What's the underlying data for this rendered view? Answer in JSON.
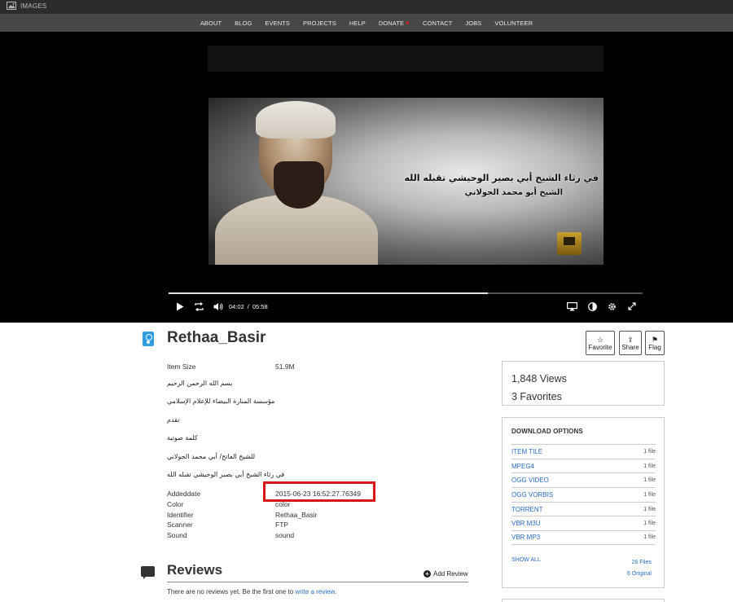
{
  "topbar": {
    "brand_label": "IMAGES",
    "brand_icon": "images-icon"
  },
  "nav": {
    "items": [
      "ABOUT",
      "BLOG",
      "EVENTS",
      "PROJECTS",
      "HELP",
      "DONATE",
      "CONTACT",
      "JOBS",
      "VOLUNTEER"
    ],
    "donate_icon": "heart-icon"
  },
  "player": {
    "caption_line1": "في رثاء الشيخ أبي بصير الوحيشي تقبله الله",
    "caption_line2": "الشيخ أبو محمد الجولاني",
    "current_time": "04:02",
    "separator": "/",
    "duration": "05:58",
    "progress_fraction": 0.674,
    "icons": [
      "play-icon",
      "loop-icon",
      "volume-icon",
      "airplay-icon",
      "contrast-icon",
      "settings-icon",
      "fullscreen-icon"
    ]
  },
  "item": {
    "title": "Rethaa_Basir",
    "type_icon": "audio-item-icon",
    "actions": [
      {
        "label": "Favorite",
        "icon": "star-icon",
        "glyph": "☆"
      },
      {
        "label": "Share",
        "icon": "share-icon",
        "glyph": "⇪"
      },
      {
        "label": "Flag",
        "icon": "flag-icon",
        "glyph": "⚑"
      }
    ],
    "item_size_label": "Item Size",
    "item_size_value": "51.9M",
    "description_lines": [
      "بسم الله الرحمن الرحيم",
      "مؤسسة المنارة البيضاء للإعلام الإسلامي",
      "تقدم",
      "كلمة صوتية",
      "للشيخ الفاتح/ أبي محمد الجولاني",
      "في رثاء الشيخ أبي بصير الوحيشي تقبله الله"
    ],
    "metadata": [
      {
        "key": "Addeddate",
        "value": "2015-06-23 16:52:27.76349"
      },
      {
        "key": "Color",
        "value": "color"
      },
      {
        "key": "Identifier",
        "value": "Rethaa_Basir"
      },
      {
        "key": "Scanner",
        "value": "FTP"
      },
      {
        "key": "Sound",
        "value": "sound"
      }
    ]
  },
  "stats": {
    "views": "1,848 Views",
    "favorites": "3 Favorites"
  },
  "downloads": {
    "title": "DOWNLOAD OPTIONS",
    "formats": [
      {
        "name": "ITEM TILE",
        "count": "1 file"
      },
      {
        "name": "MPEG4",
        "count": "1 file"
      },
      {
        "name": "OGG VIDEO",
        "count": "1 file"
      },
      {
        "name": "OGG VORBIS",
        "count": "1 file"
      },
      {
        "name": "TORRENT",
        "count": "1 file"
      },
      {
        "name": "VBR M3U",
        "count": "1 file"
      },
      {
        "name": "VBR MP3",
        "count": "1 file"
      }
    ],
    "show_all": "SHOW ALL",
    "files_count": "26 Files",
    "original_count": "6 Original"
  },
  "reviews": {
    "title": "Reviews",
    "add_label": "Add Review",
    "empty_text": "There are no reviews yet. Be the first one to ",
    "write_link": "write a review",
    "period": "."
  },
  "colors": {
    "highlight_border": "#d9151c",
    "link": "#2b6ec2",
    "nav_bg": "#474747",
    "topbar_bg": "#2c2c2c"
  }
}
